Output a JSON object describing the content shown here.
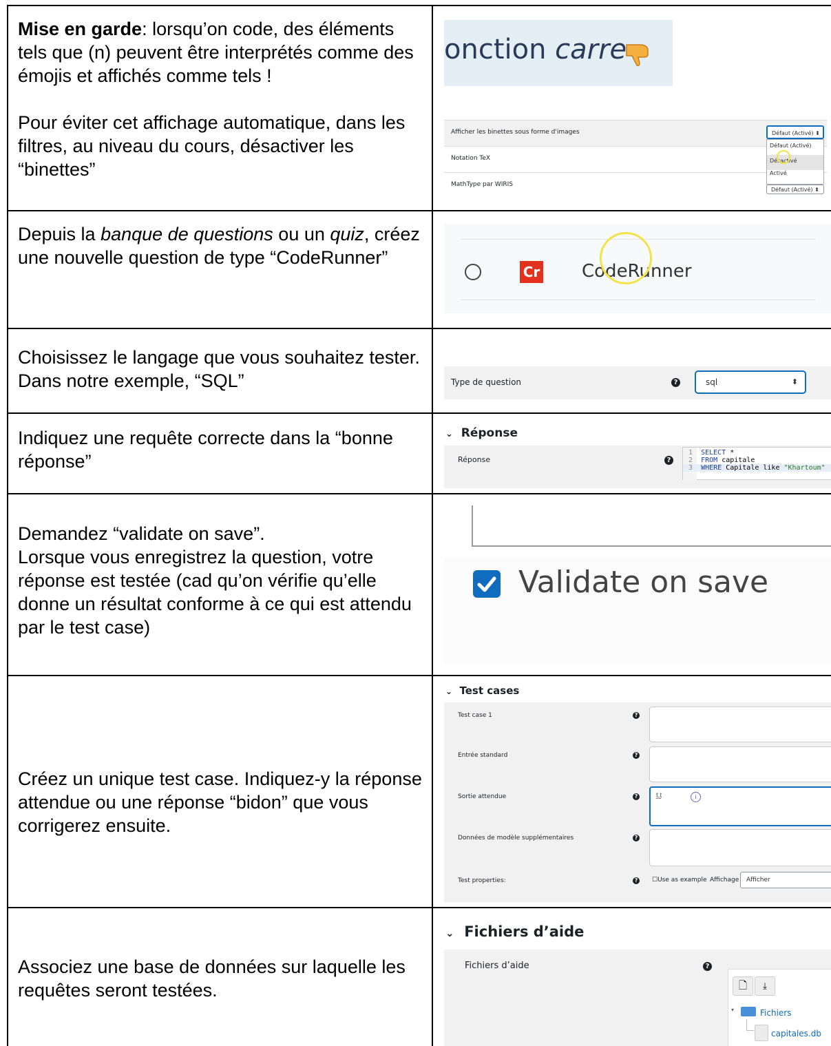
{
  "rows": [
    {
      "warning_bold": "Mise en garde",
      "warning_text": ": lorsqu’on code, des éléments tels que (n) peuvent être interprétés comme des émojis et affichés comme tels !",
      "paragraph": "Pour éviter cet affichage automatique, dans les filtres, au niveau du cours, désactiver les “binettes”",
      "shot_a": {
        "text_normal": "onction ",
        "text_italic": "carre"
      },
      "shot_b": {
        "rows": [
          "Afficher les binettes sous forme d'images",
          "Notation TeX",
          "MathType par WIRIS"
        ],
        "select_value": "Défaut (Activé)",
        "options": [
          "Défaut (Activé)",
          "Désactivé",
          "Activé"
        ],
        "select_value_2": "Défaut (Activé)"
      }
    },
    {
      "t1": "Depuis la ",
      "t2": "banque de questions",
      "t3": " ou un ",
      "t4": "quiz",
      "t5": ", créez une nouvelle question de type “CodeRunner”",
      "badge": "Cr",
      "label": "CodeRunner"
    },
    {
      "text": "Choisissez le langage que vous souhaitez tester. Dans notre exemple, “SQL”",
      "field_label": "Type de question",
      "select_value": "sql"
    },
    {
      "text": "Indiquez une requête correcte dans la “bonne réponse”",
      "section": "Réponse",
      "field_label": "Réponse",
      "code": [
        {
          "n": "1",
          "kw": "SELECT",
          "rest": " *",
          "str": ""
        },
        {
          "n": "2",
          "kw": "FROM",
          "rest": " capitale",
          "str": ""
        },
        {
          "n": "3",
          "kw": "WHERE",
          "rest": " Capitale like ",
          "str": "\"Khartoum\""
        }
      ]
    },
    {
      "line1": "Demandez “validate on save”.",
      "line2": "Lorsque vous enregistrez la question, votre réponse est testée (cad qu’on vérifie qu’elle donne un résultat conforme à ce qui est attendu par le test case)",
      "checkbox_label": "Validate on save",
      "checked": true
    },
    {
      "text": "Créez un unique test case. Indiquez-y la réponse attendue ou une réponse “bidon” que vous corrigerez ensuite.",
      "section": "Test cases",
      "fields": [
        "Test case 1",
        "Entrée standard",
        "Sortie attendue",
        "Données de modèle supplémentaires",
        "Test properties:"
      ],
      "expected_value": "t.t",
      "use_as_example": "Use as example",
      "affichage_label": "Affichage",
      "affichage_value": "Afficher"
    },
    {
      "text": "Associez une base de données sur laquelle les requêtes seront testées.",
      "section": "Fichiers d’aide",
      "field_label": "Fichiers d’aide",
      "folder": "Fichiers",
      "file": "capitales.db"
    }
  ],
  "colors": {
    "accent": "#0f6cbf",
    "coderunner_red": "#e2311d",
    "highlight_yellow": "#f1e44a"
  }
}
